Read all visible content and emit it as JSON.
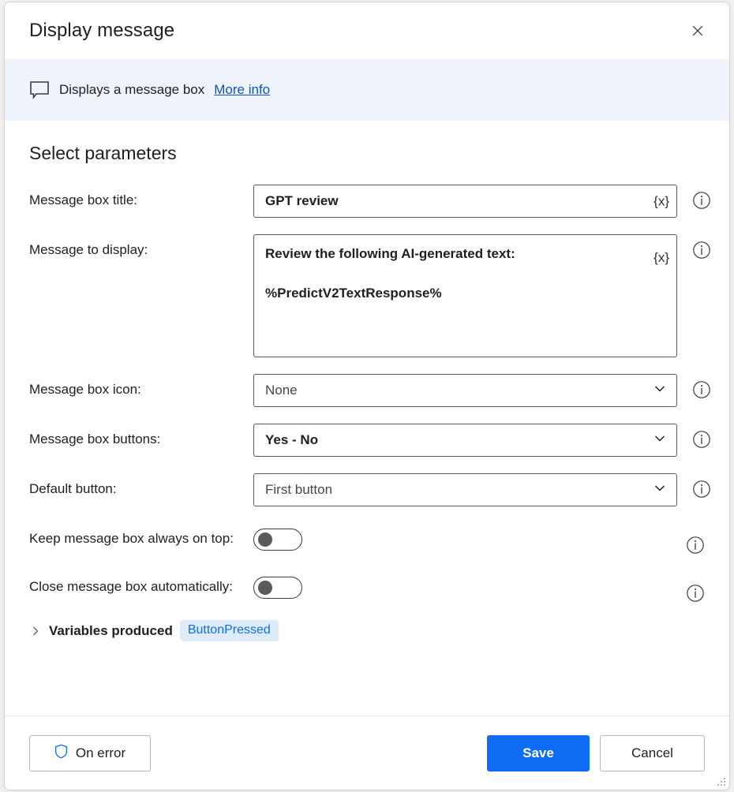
{
  "dialog": {
    "title": "Display message",
    "close_label": "Close"
  },
  "banner": {
    "icon": "message-bubble-icon",
    "text": "Displays a message box",
    "link_label": "More info"
  },
  "form": {
    "section_title": "Select parameters",
    "fields": [
      {
        "label": "Message box title:",
        "type": "text",
        "value": "GPT review",
        "variable_button": "{x}",
        "info": "i"
      },
      {
        "label": "Message to display:",
        "type": "textarea",
        "value_line1": "Review the following AI-generated text:",
        "value_line2": "%PredictV2TextResponse%",
        "variable_button": "{x}",
        "info": "i"
      },
      {
        "label": "Message box icon:",
        "type": "dropdown",
        "value": "None",
        "info": "i"
      },
      {
        "label": "Message box buttons:",
        "type": "dropdown",
        "value": "Yes - No",
        "info": "i"
      },
      {
        "label": "Default button:",
        "type": "dropdown",
        "value": "First button",
        "info": "i"
      },
      {
        "label": "Keep message box always on top:",
        "type": "toggle",
        "state": "off",
        "info": "i"
      },
      {
        "label": "Close message box automatically:",
        "type": "toggle",
        "state": "off",
        "info": "i"
      }
    ],
    "variables_produced": {
      "label": "Variables produced",
      "expanded": false,
      "badges": [
        "ButtonPressed"
      ]
    }
  },
  "footer": {
    "on_error_label": "On error",
    "save_label": "Save",
    "cancel_label": "Cancel"
  },
  "colors": {
    "accent": "#0f6cf5",
    "link": "#0f52c4",
    "banner_bg": "#eff4fc",
    "badge_bg": "#deecfa",
    "border": "#5c5a58",
    "text": "#201f1e"
  }
}
